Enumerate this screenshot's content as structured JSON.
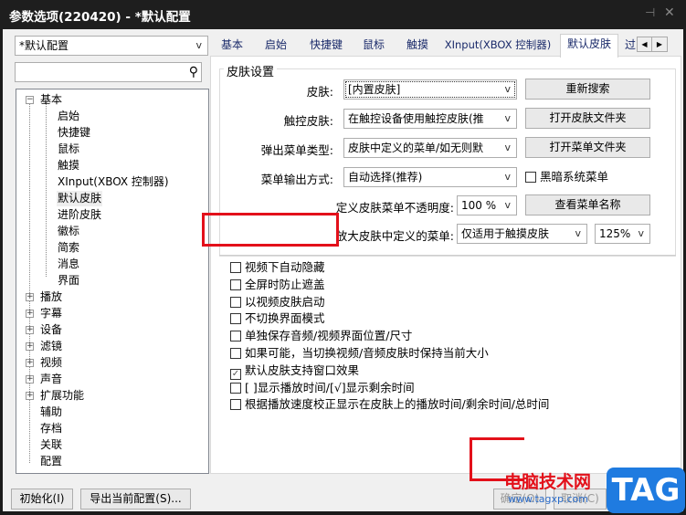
{
  "window": {
    "title": "参数选项(220420) - *默认配置",
    "pin_icon": "pin-icon",
    "close_icon": "close-icon"
  },
  "profile_combo": {
    "value": "*默认配置"
  },
  "search": {
    "value": "",
    "icon": "search-icon"
  },
  "tree": {
    "expanded": {
      "label": "基本",
      "children": [
        "启始",
        "快捷键",
        "鼠标",
        "触摸",
        "XInput(XBOX 控制器)",
        "默认皮肤",
        "进阶皮肤",
        "徽标",
        "简索",
        "消息",
        "界面"
      ]
    },
    "collapsed": [
      "播放",
      "字幕",
      "设备",
      "滤镜",
      "视频",
      "声音",
      "扩展功能"
    ],
    "leaves": [
      "辅助",
      "存档",
      "关联",
      "配置"
    ],
    "selected": "默认皮肤"
  },
  "tabs": [
    "基本",
    "启始",
    "快捷键",
    "鼠标",
    "触摸",
    "XInput(XBOX 控制器)",
    "默认皮肤",
    "过"
  ],
  "active_tab": "默认皮肤",
  "skin_settings": {
    "group_label": "皮肤设置",
    "rows": [
      {
        "label": "皮肤:",
        "value": "[内置皮肤]",
        "button": "重新搜索"
      },
      {
        "label": "触控皮肤:",
        "value": "在触控设备使用触控皮肤(推",
        "button": "打开皮肤文件夹"
      },
      {
        "label": "弹出菜单类型:",
        "value": "皮肤中定义的菜单/如无则默",
        "button": "打开菜单文件夹"
      },
      {
        "label": "菜单输出方式:",
        "value": "自动选择(推荐)",
        "checkbox": "黑暗系统菜单",
        "checked": false
      }
    ],
    "opacity": {
      "label": "定义皮肤菜单不透明度:",
      "value": "100 %",
      "button": "查看菜单名称"
    },
    "enlarge": {
      "label": "放大皮肤中定义的菜单:",
      "value": "仅适用于触摸皮肤",
      "scale": "125%"
    }
  },
  "checkboxes": [
    {
      "label": "视频下自动隐藏",
      "checked": false
    },
    {
      "label": "全屏时防止遮盖",
      "checked": false
    },
    {
      "label": "以视频皮肤启动",
      "checked": false
    },
    {
      "label": "不切换界面模式",
      "checked": false
    },
    {
      "label": "单独保存音频/视频界面位置/尺寸",
      "checked": false
    },
    {
      "label": "如果可能，当切换视频/音频皮肤时保持当前大小",
      "checked": false
    },
    {
      "label": "默认皮肤支持窗口效果",
      "checked": true
    },
    {
      "label": "[  ]显示播放时间/[√]显示剩余时间",
      "checked": false
    },
    {
      "label": "根据播放速度校正显示在皮肤上的播放时间/剩余时间/总时间",
      "checked": false
    }
  ],
  "footer": {
    "init": "初始化(I)",
    "export": "导出当前配置(S)...",
    "ok": "确定(O)",
    "cancel": "取消(C)"
  },
  "watermark": {
    "text": "电脑技术网",
    "url": "www.tagxp.com",
    "logo": "TAG"
  },
  "colors": {
    "highlight": "#e3101a",
    "titlebar": "#1e1e1e",
    "tab_text": "#1a2a6a"
  }
}
